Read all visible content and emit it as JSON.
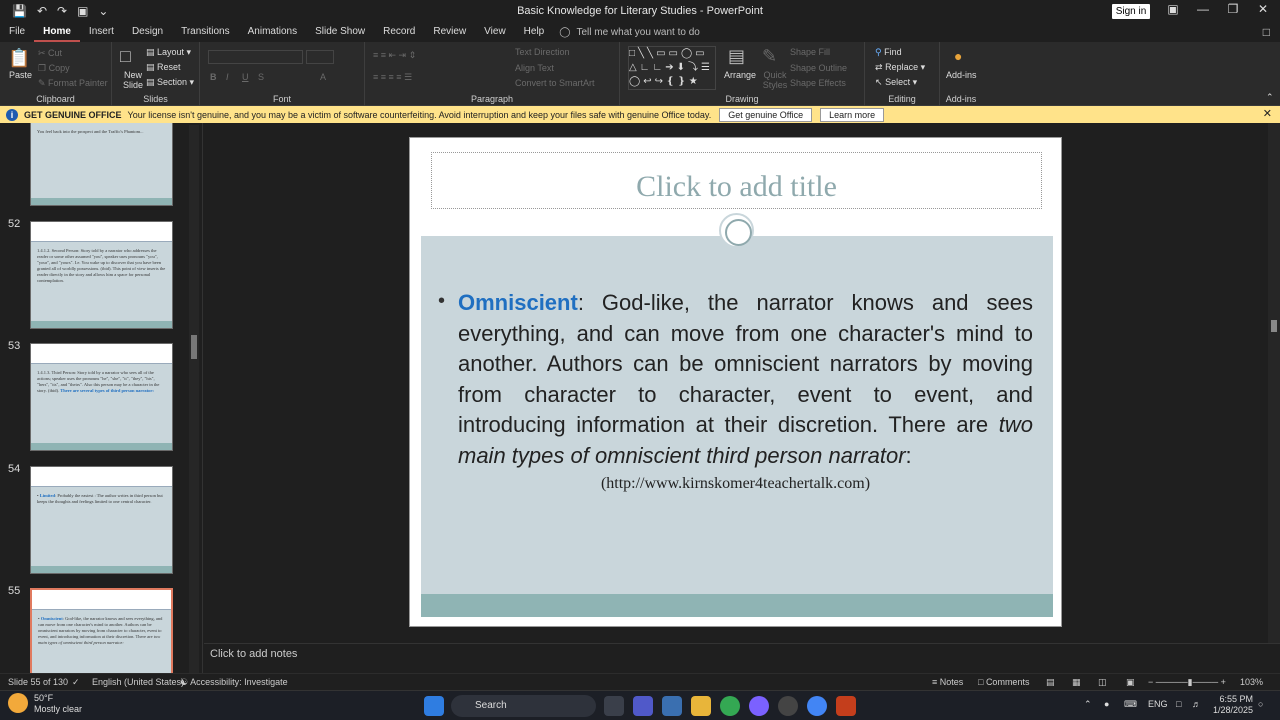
{
  "window": {
    "title": "Basic Knowledge for Literary Studies  -  PowerPoint",
    "sign_in": "Sign in"
  },
  "tabs": [
    {
      "label": "File"
    },
    {
      "label": "Home",
      "active": true
    },
    {
      "label": "Insert"
    },
    {
      "label": "Design"
    },
    {
      "label": "Transitions"
    },
    {
      "label": "Animations"
    },
    {
      "label": "Slide Show"
    },
    {
      "label": "Record"
    },
    {
      "label": "Review"
    },
    {
      "label": "View"
    },
    {
      "label": "Help"
    }
  ],
  "tell_me": "Tell me what you want to do",
  "ribbon": {
    "clipboard": {
      "label": "Clipboard",
      "paste": "Paste",
      "cut": "Cut",
      "copy": "Copy",
      "format_painter": "Format Painter"
    },
    "slides": {
      "label": "Slides",
      "new_slide": "New Slide",
      "layout": "Layout",
      "reset": "Reset",
      "section": "Section"
    },
    "font": {
      "label": "Font"
    },
    "paragraph": {
      "label": "Paragraph",
      "text_direction": "Text Direction",
      "align_text": "Align Text",
      "convert": "Convert to SmartArt"
    },
    "drawing": {
      "label": "Drawing",
      "arrange": "Arrange",
      "quick_styles": "Quick Styles",
      "shape_fill": "Shape Fill",
      "shape_outline": "Shape Outline",
      "shape_effects": "Shape Effects"
    },
    "editing": {
      "label": "Editing",
      "find": "Find",
      "replace": "Replace",
      "select": "Select"
    },
    "addins": {
      "label": "Add-ins",
      "addins_btn": "Add-ins"
    }
  },
  "notice": {
    "badge": "GET GENUINE OFFICE",
    "text": "Your license isn't genuine, and you may be a victim of software counterfeiting. Avoid interruption and keep your files safe with genuine Office today.",
    "button1": "Get genuine Office",
    "button2": "Learn more"
  },
  "thumbnails": [
    {
      "num": "",
      "text": "You feel back into the prospect and the Traffic's Phantom..."
    },
    {
      "num": "52",
      "text": "1.4.1.2. Second Person: Story told by a narrator who addresses the reader or some other assumed \"you\", speaker uses pronouns \"you\", \"your\", and \"yours\". I.e. You wake up to discover that you have been granted all of worldly possessions. (ibid). This point of view inserts the reader directly in the story and allows him a space for personal contemplation."
    },
    {
      "num": "53",
      "text": "1.4.1.3. Third Person: Story told by a narrator who sees all of the actions; speaker uses the pronouns \"he\", \"she\", \"it\", \"they\", \"his\", \"hers\", \"its\", and \"theirs\". Also this person may be a character in the story. (ibid).",
      "highlight": "There are several types of third person narrator:"
    },
    {
      "num": "54",
      "keyword": "Limited",
      "text": ": Probably the easiest : The author writes in third person but keeps the thoughts and feelings limited to one central character."
    },
    {
      "num": "55",
      "keyword": "Omniscient",
      "text": ": God-like, the narrator knows and sees everything, and can move from one character's mind to another. Authors can be omniscient narrators by moving from character to character, event to event, and introducing information at their discretion. There are",
      "italic": "two main types of omniscient third person narrator:",
      "selected": true
    }
  ],
  "slide": {
    "title_placeholder": "Click to add title",
    "keyword": "Omniscient",
    "body": ": God-like, the narrator knows and sees everything, and can move from one character's mind to another. Authors can be omniscient narrators by moving from character to character, event to event, and introducing information at their discretion. There are ",
    "italic": "two main types of omniscient third person narrator",
    "colon": ":",
    "source": "(http://www.kirnskomer4teachertalk.com)"
  },
  "notes_placeholder": "Click to add notes",
  "status": {
    "slide_counter": "Slide 55 of 130",
    "language": "English (United States)",
    "accessibility": "Accessibility: Investigate",
    "notes": "Notes",
    "comments": "Comments",
    "zoom": "103%"
  },
  "taskbar": {
    "temp": "50°F",
    "weather": "Mostly clear",
    "search": "Search",
    "lang": "ENG",
    "time": "6:55 PM",
    "date": "1/28/2025"
  },
  "colors": {
    "accent": "#c0504d",
    "keyword_blue": "#1f6fc1",
    "slide_body": "#c9d6db",
    "notice_bg": "#ffe38a"
  }
}
